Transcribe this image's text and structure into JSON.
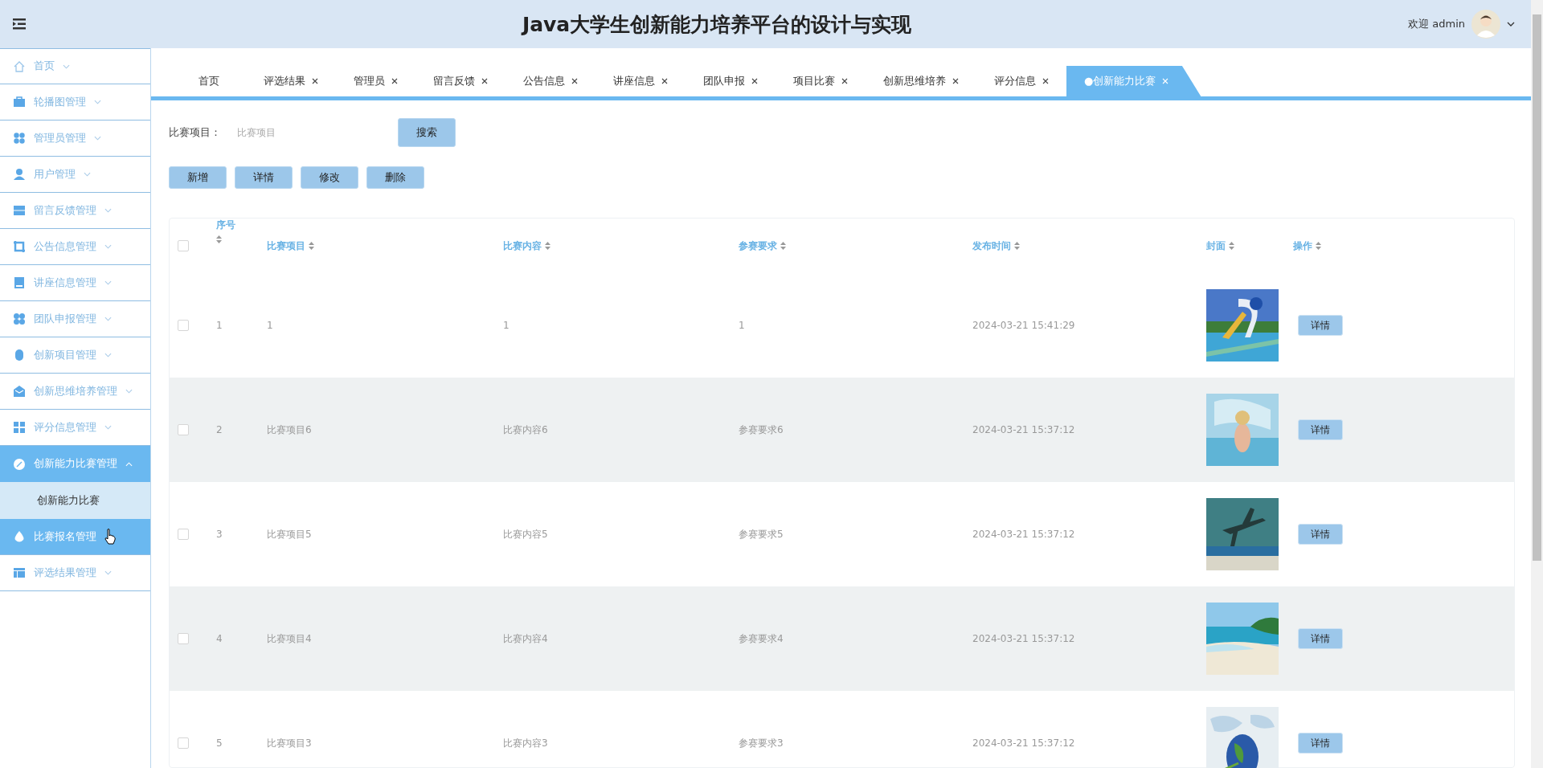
{
  "header": {
    "title": "Java大学生创新能力培养平台的设计与实现",
    "welcome": "欢迎 admin"
  },
  "sidebar": {
    "items": [
      {
        "label": "首页",
        "collapsible": true,
        "expanded": false,
        "selected": false,
        "hovered": false
      },
      {
        "label": "轮播图管理",
        "collapsible": true,
        "expanded": false,
        "selected": false,
        "hovered": false
      },
      {
        "label": "管理员管理",
        "collapsible": true,
        "expanded": false,
        "selected": false,
        "hovered": false
      },
      {
        "label": "用户管理",
        "collapsible": true,
        "expanded": false,
        "selected": false,
        "hovered": false
      },
      {
        "label": "留言反馈管理",
        "collapsible": true,
        "expanded": false,
        "selected": false,
        "hovered": false
      },
      {
        "label": "公告信息管理",
        "collapsible": true,
        "expanded": false,
        "selected": false,
        "hovered": false
      },
      {
        "label": "讲座信息管理",
        "collapsible": true,
        "expanded": false,
        "selected": false,
        "hovered": false
      },
      {
        "label": "团队申报管理",
        "collapsible": true,
        "expanded": false,
        "selected": false,
        "hovered": false
      },
      {
        "label": "创新项目管理",
        "collapsible": true,
        "expanded": false,
        "selected": false,
        "hovered": false
      },
      {
        "label": "创新思维培养管理",
        "collapsible": true,
        "expanded": false,
        "selected": false,
        "hovered": false
      },
      {
        "label": "评分信息管理",
        "collapsible": true,
        "expanded": false,
        "selected": false,
        "hovered": false
      },
      {
        "label": "创新能力比赛管理",
        "collapsible": true,
        "expanded": true,
        "selected": true,
        "hovered": false,
        "children": [
          {
            "label": "创新能力比赛",
            "selected": true
          }
        ]
      },
      {
        "label": "比赛报名管理",
        "collapsible": false,
        "expanded": false,
        "selected": false,
        "hovered": true
      },
      {
        "label": "评选结果管理",
        "collapsible": true,
        "expanded": false,
        "selected": false,
        "hovered": false
      }
    ]
  },
  "tabs": [
    {
      "label": "首页",
      "closable": false,
      "selected": false
    },
    {
      "label": "评选结果",
      "closable": true,
      "selected": false
    },
    {
      "label": "管理员",
      "closable": true,
      "selected": false
    },
    {
      "label": "留言反馈",
      "closable": true,
      "selected": false
    },
    {
      "label": "公告信息",
      "closable": true,
      "selected": false
    },
    {
      "label": "讲座信息",
      "closable": true,
      "selected": false
    },
    {
      "label": "团队申报",
      "closable": true,
      "selected": false
    },
    {
      "label": "项目比赛",
      "closable": true,
      "selected": false
    },
    {
      "label": "创新思维培养",
      "closable": true,
      "selected": false
    },
    {
      "label": "评分信息",
      "closable": true,
      "selected": false
    },
    {
      "label": "●创新能力比赛",
      "closable": true,
      "selected": true
    }
  ],
  "search": {
    "label": "比赛项目：",
    "placeholder": "比赛项目",
    "button": "搜索"
  },
  "actions": [
    "新增",
    "详情",
    "修改",
    "删除"
  ],
  "table": {
    "select_all": {
      "checked": false
    },
    "columns": [
      {
        "label": "序号",
        "sortable": true
      },
      {
        "label": "比赛项目",
        "sortable": true
      },
      {
        "label": "比赛内容",
        "sortable": true
      },
      {
        "label": "参赛要求",
        "sortable": true
      },
      {
        "label": "发布时间",
        "sortable": true
      },
      {
        "label": "封面",
        "sortable": true
      },
      {
        "label": "操作",
        "sortable": true
      }
    ],
    "rows": [
      {
        "checked": false,
        "cells": [
          "1",
          "1",
          "1",
          "1",
          "2024-03-21 15:41:29"
        ],
        "action": "详情"
      },
      {
        "checked": false,
        "cells": [
          "2",
          "比赛项目6",
          "比赛内容6",
          "参赛要求6",
          "2024-03-21 15:37:12"
        ],
        "action": "详情"
      },
      {
        "checked": false,
        "cells": [
          "3",
          "比赛项目5",
          "比赛内容5",
          "参赛要求5",
          "2024-03-21 15:37:12"
        ],
        "action": "详情"
      },
      {
        "checked": false,
        "cells": [
          "4",
          "比赛项目4",
          "比赛内容4",
          "参赛要求4",
          "2024-03-21 15:37:12"
        ],
        "action": "详情"
      },
      {
        "checked": false,
        "cells": [
          "5",
          "比赛项目3",
          "比赛内容3",
          "参赛要求3",
          "2024-03-21 15:37:12"
        ],
        "action": "详情"
      }
    ]
  }
}
